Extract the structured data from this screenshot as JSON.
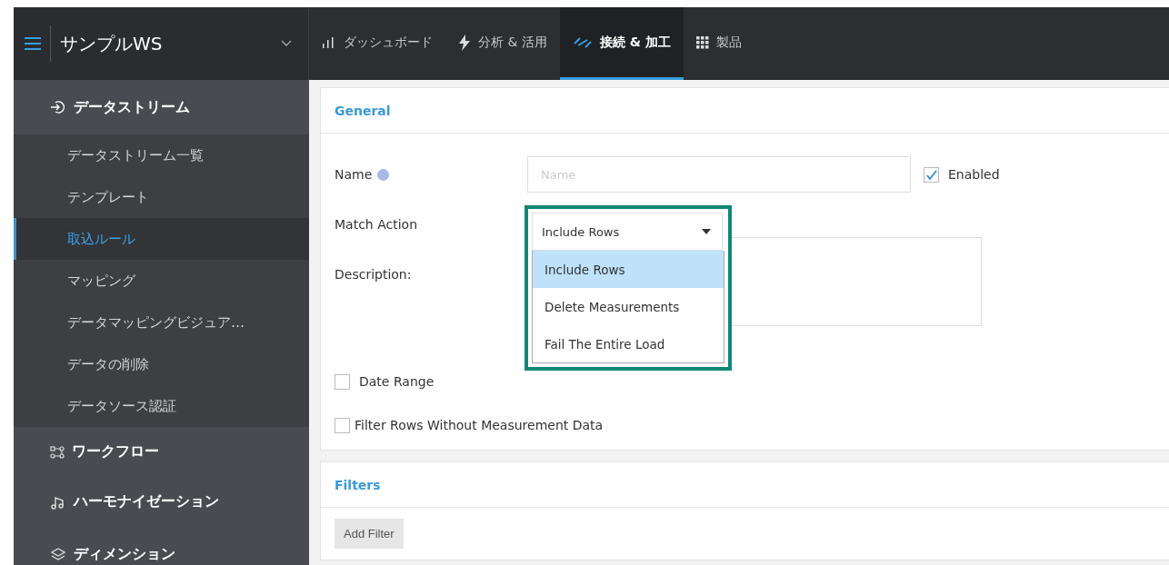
{
  "header": {
    "workspace": "サンプルWS",
    "tabs": [
      {
        "label": "ダッシュボード",
        "selected": false
      },
      {
        "label": "分析 & 活用",
        "selected": false
      },
      {
        "label": "接続 & 加工",
        "selected": true
      },
      {
        "label": "製品",
        "selected": false
      }
    ]
  },
  "sidebar": {
    "sections": [
      {
        "label": "データストリーム",
        "expanded": true,
        "children": [
          {
            "label": "データストリーム一覧",
            "selected": false
          },
          {
            "label": "テンプレート",
            "selected": false
          },
          {
            "label": "取込ルール",
            "selected": true
          },
          {
            "label": "マッピング",
            "selected": false
          },
          {
            "label": "データマッピングビジュア…",
            "selected": false
          },
          {
            "label": "データの削除",
            "selected": false
          },
          {
            "label": "データソース認証",
            "selected": false
          }
        ]
      },
      {
        "label": "ワークフロー",
        "expanded": false
      },
      {
        "label": "ハーモナイゼーション",
        "expanded": false
      },
      {
        "label": "ディメンション",
        "expanded": false
      }
    ]
  },
  "general": {
    "title": "General",
    "name_label": "Name",
    "name_placeholder": "Name",
    "enabled": {
      "label": "Enabled",
      "checked": true
    },
    "match_action": {
      "label": "Match Action",
      "value": "Include Rows",
      "expanded": true,
      "options": [
        {
          "label": "Include Rows",
          "selected": true
        },
        {
          "label": "Delete Measurements",
          "selected": false
        },
        {
          "label": "Fail The Entire Load",
          "selected": false
        }
      ]
    },
    "description_label": "Description:",
    "checkboxes": [
      {
        "label": "Date Range",
        "checked": false
      },
      {
        "label": "Filter Rows Without Measurement Data",
        "checked": false
      }
    ]
  },
  "filters": {
    "title": "Filters",
    "button": "Add Filter"
  }
}
